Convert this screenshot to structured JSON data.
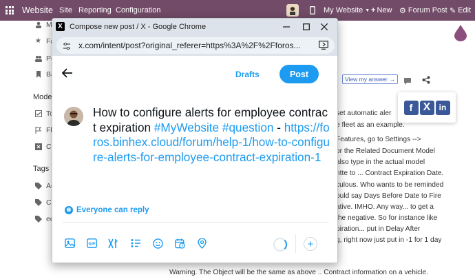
{
  "topbar": {
    "brand": "Website",
    "menu": [
      "Site",
      "Reporting",
      "Configuration"
    ],
    "website_selector": "My Website",
    "new_label": "New",
    "forum_post_label": "Forum Post",
    "edit_label": "Edit",
    "bg_color": "#714B67"
  },
  "background": {
    "sidebar_top": [
      "M",
      "Fa",
      "Pe",
      "Ba"
    ],
    "moderation_heading": "Mode",
    "moderation_items": [
      "To",
      "Fla",
      "Cl"
    ],
    "tags_heading": "Tags",
    "tag_items": [
      "Ac",
      "Co",
      "ed"
    ],
    "answer_button": "View my answer",
    "right_text": [
      "set automatic aler",
      "e fleet as an example.",
      "Features, go to Settings -->",
      "or the Related Document Model",
      "also type in the actual model",
      "ntte to ... Contract Expiration Date.",
      "culous. Who wants to be reminded",
      "ould say Days Before Date to Fire",
      "ative. IMHO. Any way... to get a",
      "the negative. So for instance like",
      "piration... put in Delay After",
      "g, right now just put in -1 for 1 day"
    ],
    "bottom_text": [
      "Warning. The Object will be the same as above .. Contract information on a vehicle."
    ]
  },
  "window": {
    "title": "Compose new post / X - Google Chrome",
    "url": "x.com/intent/post?original_referer=https%3A%2F%2Fforos...",
    "favicon": "x-logo-icon"
  },
  "compose": {
    "drafts_label": "Drafts",
    "post_label": "Post",
    "text_plain": "How to configure alerts for employee contract expiration ",
    "hashtag1": "#MyWebsite",
    "hashtag2": "#question",
    "dash": " -",
    "link": "https://foros.binhex.cloud/forum/help-1/how-to-configure-alerts-for-employee-contract-expiration-1",
    "reply_setting": "Everyone can reply",
    "toolbar_icons": [
      "image-icon",
      "gif-icon",
      "grok-icon",
      "poll-icon",
      "emoji-icon",
      "schedule-icon",
      "location-icon"
    ],
    "accent": "#1d9bf0"
  }
}
